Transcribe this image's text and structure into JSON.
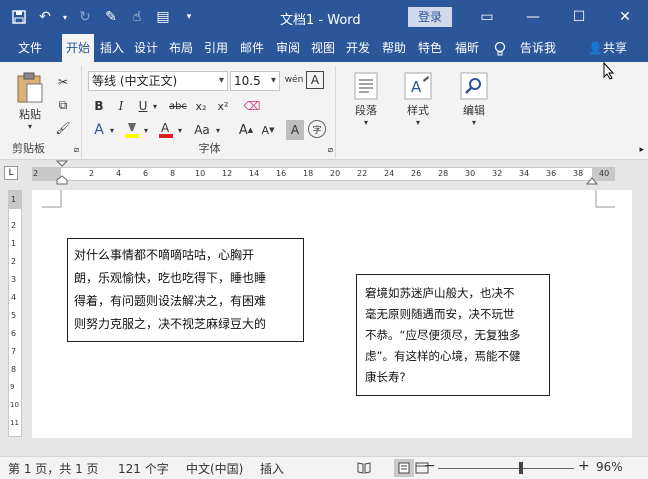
{
  "title_bar": {
    "doc_title": "文档1  -  Word",
    "login_label": "登录"
  },
  "tabs": [
    {
      "label": "文件"
    },
    {
      "label": "开始"
    },
    {
      "label": "插入"
    },
    {
      "label": "设计"
    },
    {
      "label": "布局"
    },
    {
      "label": "引用"
    },
    {
      "label": "邮件"
    },
    {
      "label": "审阅"
    },
    {
      "label": "视图"
    },
    {
      "label": "开发"
    },
    {
      "label": "帮助"
    },
    {
      "label": "特色"
    },
    {
      "label": "福昕"
    }
  ],
  "tell_me": "告诉我",
  "share": "共享",
  "ribbon": {
    "clipboard": {
      "paste_label": "粘贴",
      "group_label": "剪贴板"
    },
    "font": {
      "font_name": "等线 (中文正文)",
      "font_size": "10.5",
      "group_label": "字体"
    },
    "paragraph": {
      "label": "段落"
    },
    "styles": {
      "label": "样式"
    },
    "editing": {
      "label": "编辑"
    }
  },
  "ruler": {
    "labels": [
      "2",
      "2",
      "4",
      "6",
      "8",
      "10",
      "12",
      "14",
      "16",
      "18",
      "20",
      "22",
      "24",
      "26",
      "28",
      "30",
      "32",
      "34",
      "36",
      "38",
      "40"
    ],
    "vlabels": [
      "1",
      "2",
      "1",
      "2",
      "3",
      "4",
      "5",
      "6",
      "7",
      "8",
      "9",
      "10",
      "11",
      "12"
    ]
  },
  "document": {
    "textbox1": [
      "对什么事情都不嘀嘀咕咕，心胸开",
      "朗，乐观愉快，吃也吃得下，睡也睡",
      "得着，有问题则设法解决之，有困难",
      "则努力克服之，决不视芝麻绿豆大的"
    ],
    "textbox2": [
      "窘境如苏迷庐山般大，也决不",
      "毫无原则随遇而安，决不玩世",
      "不恭。“应尽便须尽，无复独多",
      "虑”。有这样的心境，焉能不健",
      "康长寿?"
    ]
  },
  "status": {
    "page": "第 1 页，共 1 页",
    "words": "121 个字",
    "language": "中文(中国)",
    "mode": "插入",
    "zoom": "96%"
  },
  "colors": {
    "brand": "#2b579a",
    "highlight": "#ffff00",
    "font_color": "#e02020"
  }
}
